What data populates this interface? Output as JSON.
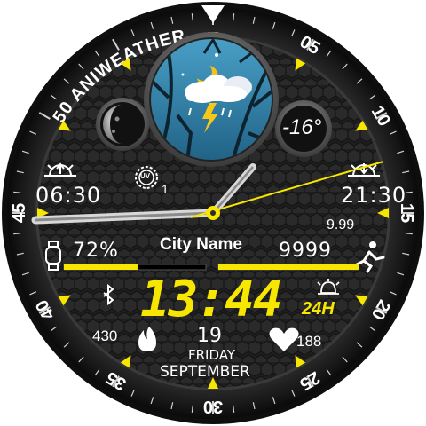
{
  "bezel": {
    "brand_text": "50 ANIWEATHER",
    "numbers": [
      "05",
      "10",
      "15",
      "20",
      "25",
      "30",
      "35",
      "40",
      "45"
    ]
  },
  "weather": {
    "temperature": "-16°",
    "uv_index": "1",
    "uv_label": "UV",
    "humidity": "72%",
    "pressure": "9.99",
    "city": "City Name"
  },
  "sun": {
    "sunrise": "06:30",
    "sunset": "21:30"
  },
  "time": {
    "digital": "13:44",
    "format": "24H"
  },
  "activity": {
    "steps": "9999",
    "calories": "430",
    "heart_rate": "188",
    "humidity_progress": 0.72,
    "steps_progress": 1.0
  },
  "date": {
    "day": "19",
    "weekday": "FRIDAY",
    "month": "SEPTEMBER"
  },
  "colors": {
    "accent": "#f7e600",
    "text": "#ffffff",
    "bezel": "#1c1c1c",
    "dial": "#2b2b2b"
  },
  "icons": {
    "weather": "moon-cloud-storm-icon",
    "sunrise": "sunrise-icon",
    "sunset": "sunset-icon",
    "uv": "sun-uv-icon",
    "watch": "watch-icon",
    "runner": "running-icon",
    "bluetooth": "bluetooth-icon",
    "alarm": "alarm-icon",
    "calories": "flame-icon",
    "heart": "heart-icon",
    "moon": "moon-phase-icon"
  }
}
